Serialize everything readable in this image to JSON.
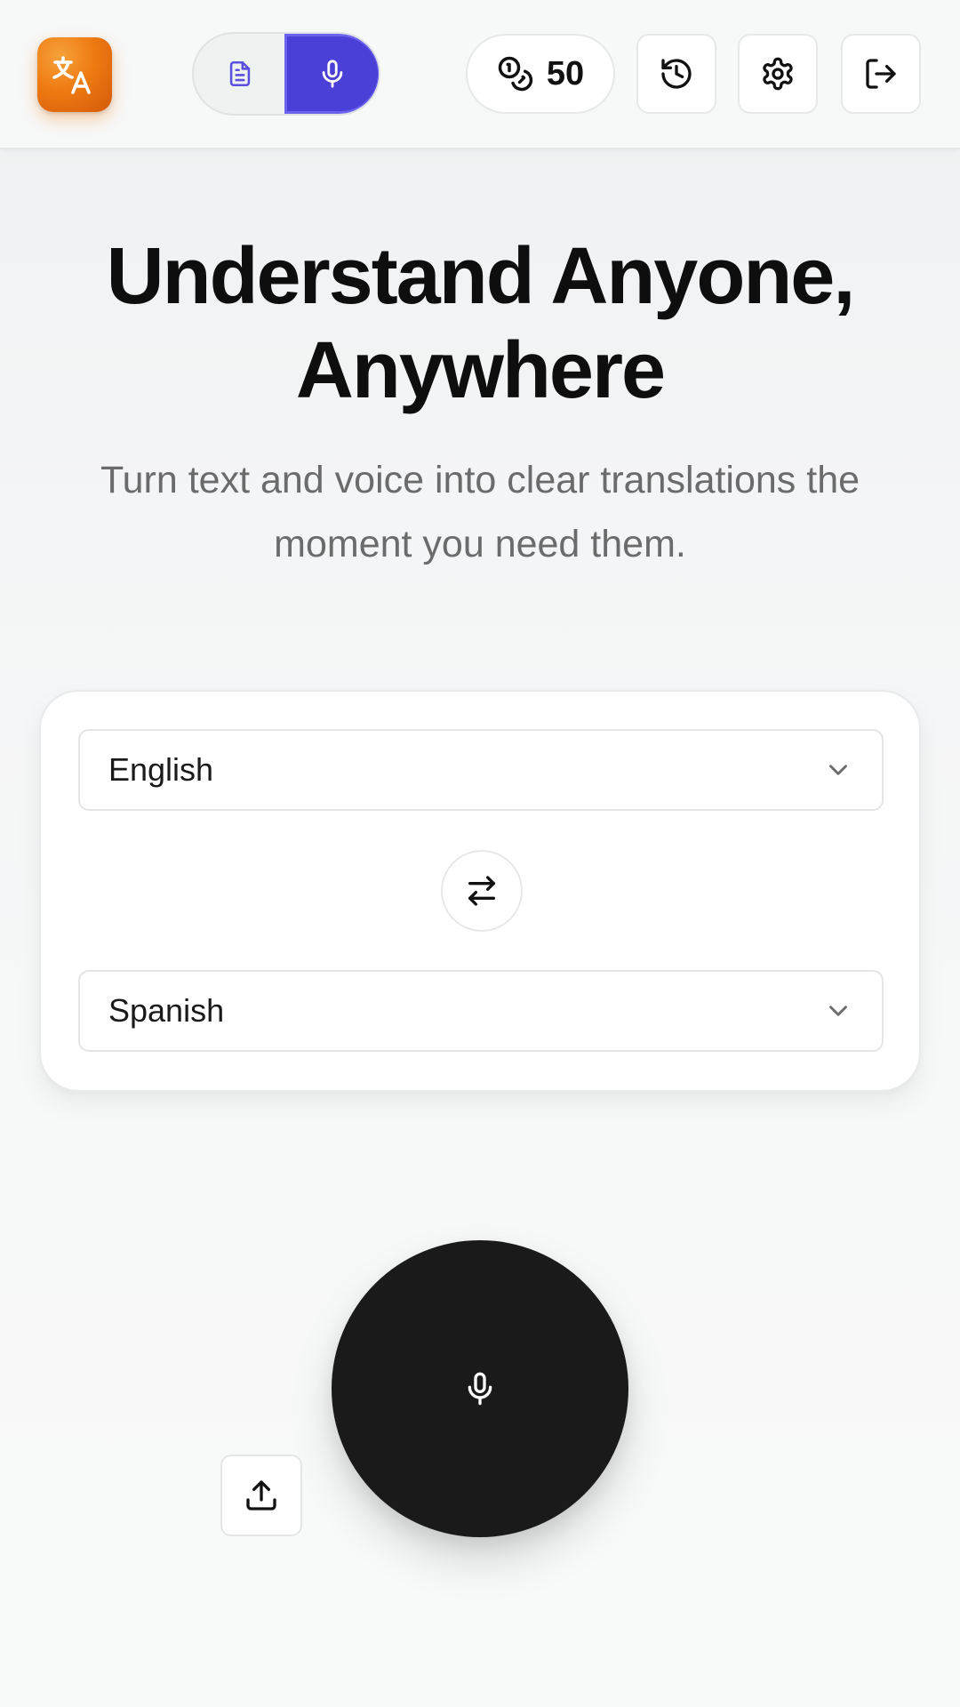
{
  "header": {
    "logo_icon": "translate-icon",
    "logo_colors": {
      "start": "#f7a13a",
      "end": "#d4580a"
    },
    "mode_toggle": {
      "options": [
        {
          "id": "text",
          "icon": "document-icon",
          "selected": false
        },
        {
          "id": "voice",
          "icon": "microphone-icon",
          "selected": true
        }
      ],
      "accent_color": "#4a3fd6"
    },
    "credits": {
      "icon": "coins-icon",
      "value": "50"
    },
    "actions": [
      {
        "id": "history",
        "icon": "history-icon"
      },
      {
        "id": "settings",
        "icon": "gear-icon"
      },
      {
        "id": "logout",
        "icon": "logout-icon"
      }
    ]
  },
  "hero": {
    "title_line1": "Understand Anyone,",
    "title_line2": "Anywhere",
    "subtitle_line1": "Turn text and voice into clear translations the",
    "subtitle_line2": "moment you need them."
  },
  "languages": {
    "source": "English",
    "target": "Spanish",
    "swap_icon": "swap-arrows-icon",
    "dropdown_icon": "chevron-down-icon"
  },
  "recorder": {
    "record_icon": "microphone-icon",
    "record_color": "#1a1a1a",
    "upload_icon": "upload-icon"
  }
}
